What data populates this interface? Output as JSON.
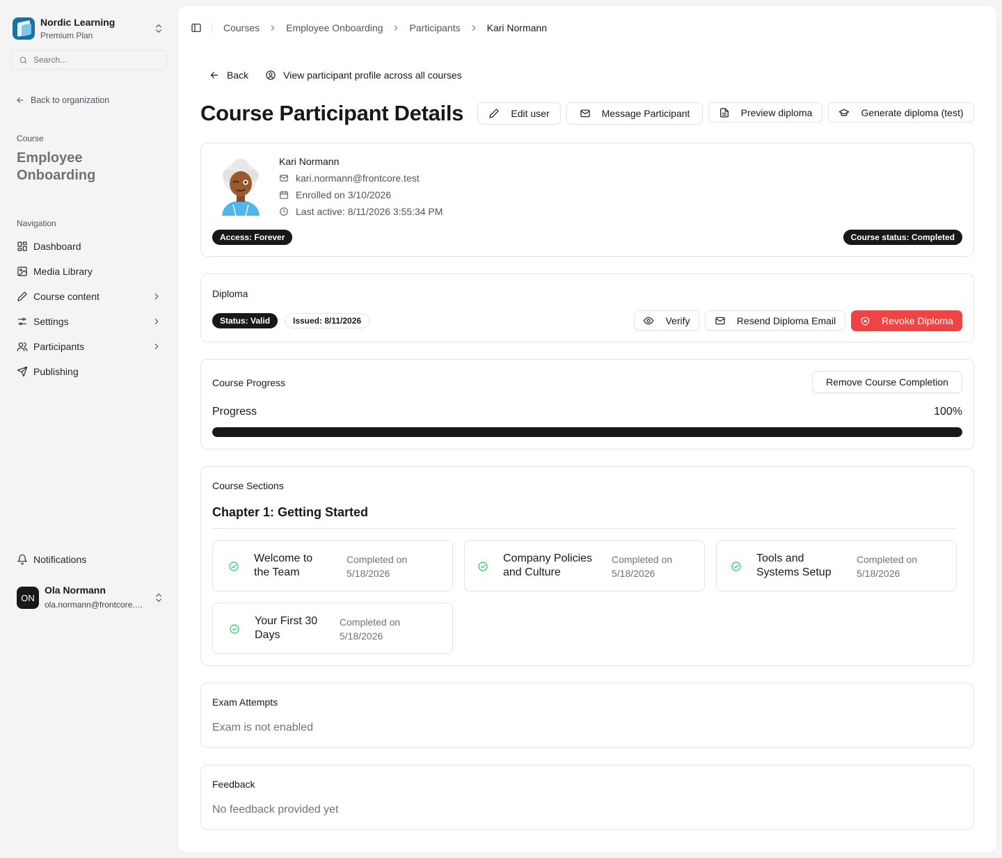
{
  "org": {
    "name": "Nordic Learning",
    "plan": "Premium Plan"
  },
  "search": {
    "placeholder": "Search..."
  },
  "sidebar": {
    "back_label": "Back to organization",
    "course_label": "Course",
    "course_title": "Employee Onboarding",
    "nav_label": "Navigation",
    "items": [
      {
        "label": "Dashboard",
        "icon": "dashboard-icon",
        "has_chevron": false
      },
      {
        "label": "Media Library",
        "icon": "image-icon",
        "has_chevron": false
      },
      {
        "label": "Course content",
        "icon": "pencil-icon",
        "has_chevron": true
      },
      {
        "label": "Settings",
        "icon": "sliders-icon",
        "has_chevron": true
      },
      {
        "label": "Participants",
        "icon": "users-icon",
        "has_chevron": true
      },
      {
        "label": "Publishing",
        "icon": "send-icon",
        "has_chevron": false
      }
    ],
    "notifications_label": "Notifications",
    "user": {
      "initials": "ON",
      "name": "Ola Normann",
      "email": "ola.normann@frontcore.test"
    }
  },
  "breadcrumb": [
    "Courses",
    "Employee Onboarding",
    "Participants",
    "Kari Normann"
  ],
  "links": {
    "back": "Back",
    "profile": "View participant profile across all courses"
  },
  "page_title": "Course Participant Details",
  "actions": {
    "edit": "Edit user",
    "message": "Message Participant",
    "preview": "Preview diploma",
    "generate": "Generate diploma (test)"
  },
  "participant": {
    "name": "Kari Normann",
    "email": "kari.normann@frontcore.test",
    "enrolled": "Enrolled on 3/10/2026",
    "last_active": "Last active: 8/11/2026 3:55:34 PM",
    "access_badge": "Access: Forever",
    "status_badge": "Course status: Completed"
  },
  "diploma": {
    "title": "Diploma",
    "status": "Status: Valid",
    "issued": "Issued: 8/11/2026",
    "verify": "Verify",
    "resend": "Resend Diploma Email",
    "revoke": "Revoke Diploma"
  },
  "progress": {
    "title": "Course Progress",
    "remove_label": "Remove Course Completion",
    "label": "Progress",
    "value_text": "100%",
    "fraction": 1.0
  },
  "sections": {
    "title": "Course Sections",
    "chapter": "Chapter 1: Getting Started",
    "lessons": [
      {
        "name": "Welcome to the Team",
        "completed_label": "Completed on",
        "date": "5/18/2026"
      },
      {
        "name": "Company Policies and Culture",
        "completed_label": "Completed on",
        "date": "5/18/2026"
      },
      {
        "name": "Tools and Systems Setup",
        "completed_label": "Completed on",
        "date": "5/18/2026"
      },
      {
        "name": "Your First 30 Days",
        "completed_label": "Completed on",
        "date": "5/18/2026"
      }
    ]
  },
  "exam": {
    "title": "Exam Attempts",
    "text": "Exam is not enabled"
  },
  "feedback": {
    "title": "Feedback",
    "text": "No feedback provided yet"
  },
  "colors": {
    "accent": "#18181b",
    "danger": "#ef4444",
    "success": "#22c55e",
    "org_brand": "#1d6fa5"
  }
}
